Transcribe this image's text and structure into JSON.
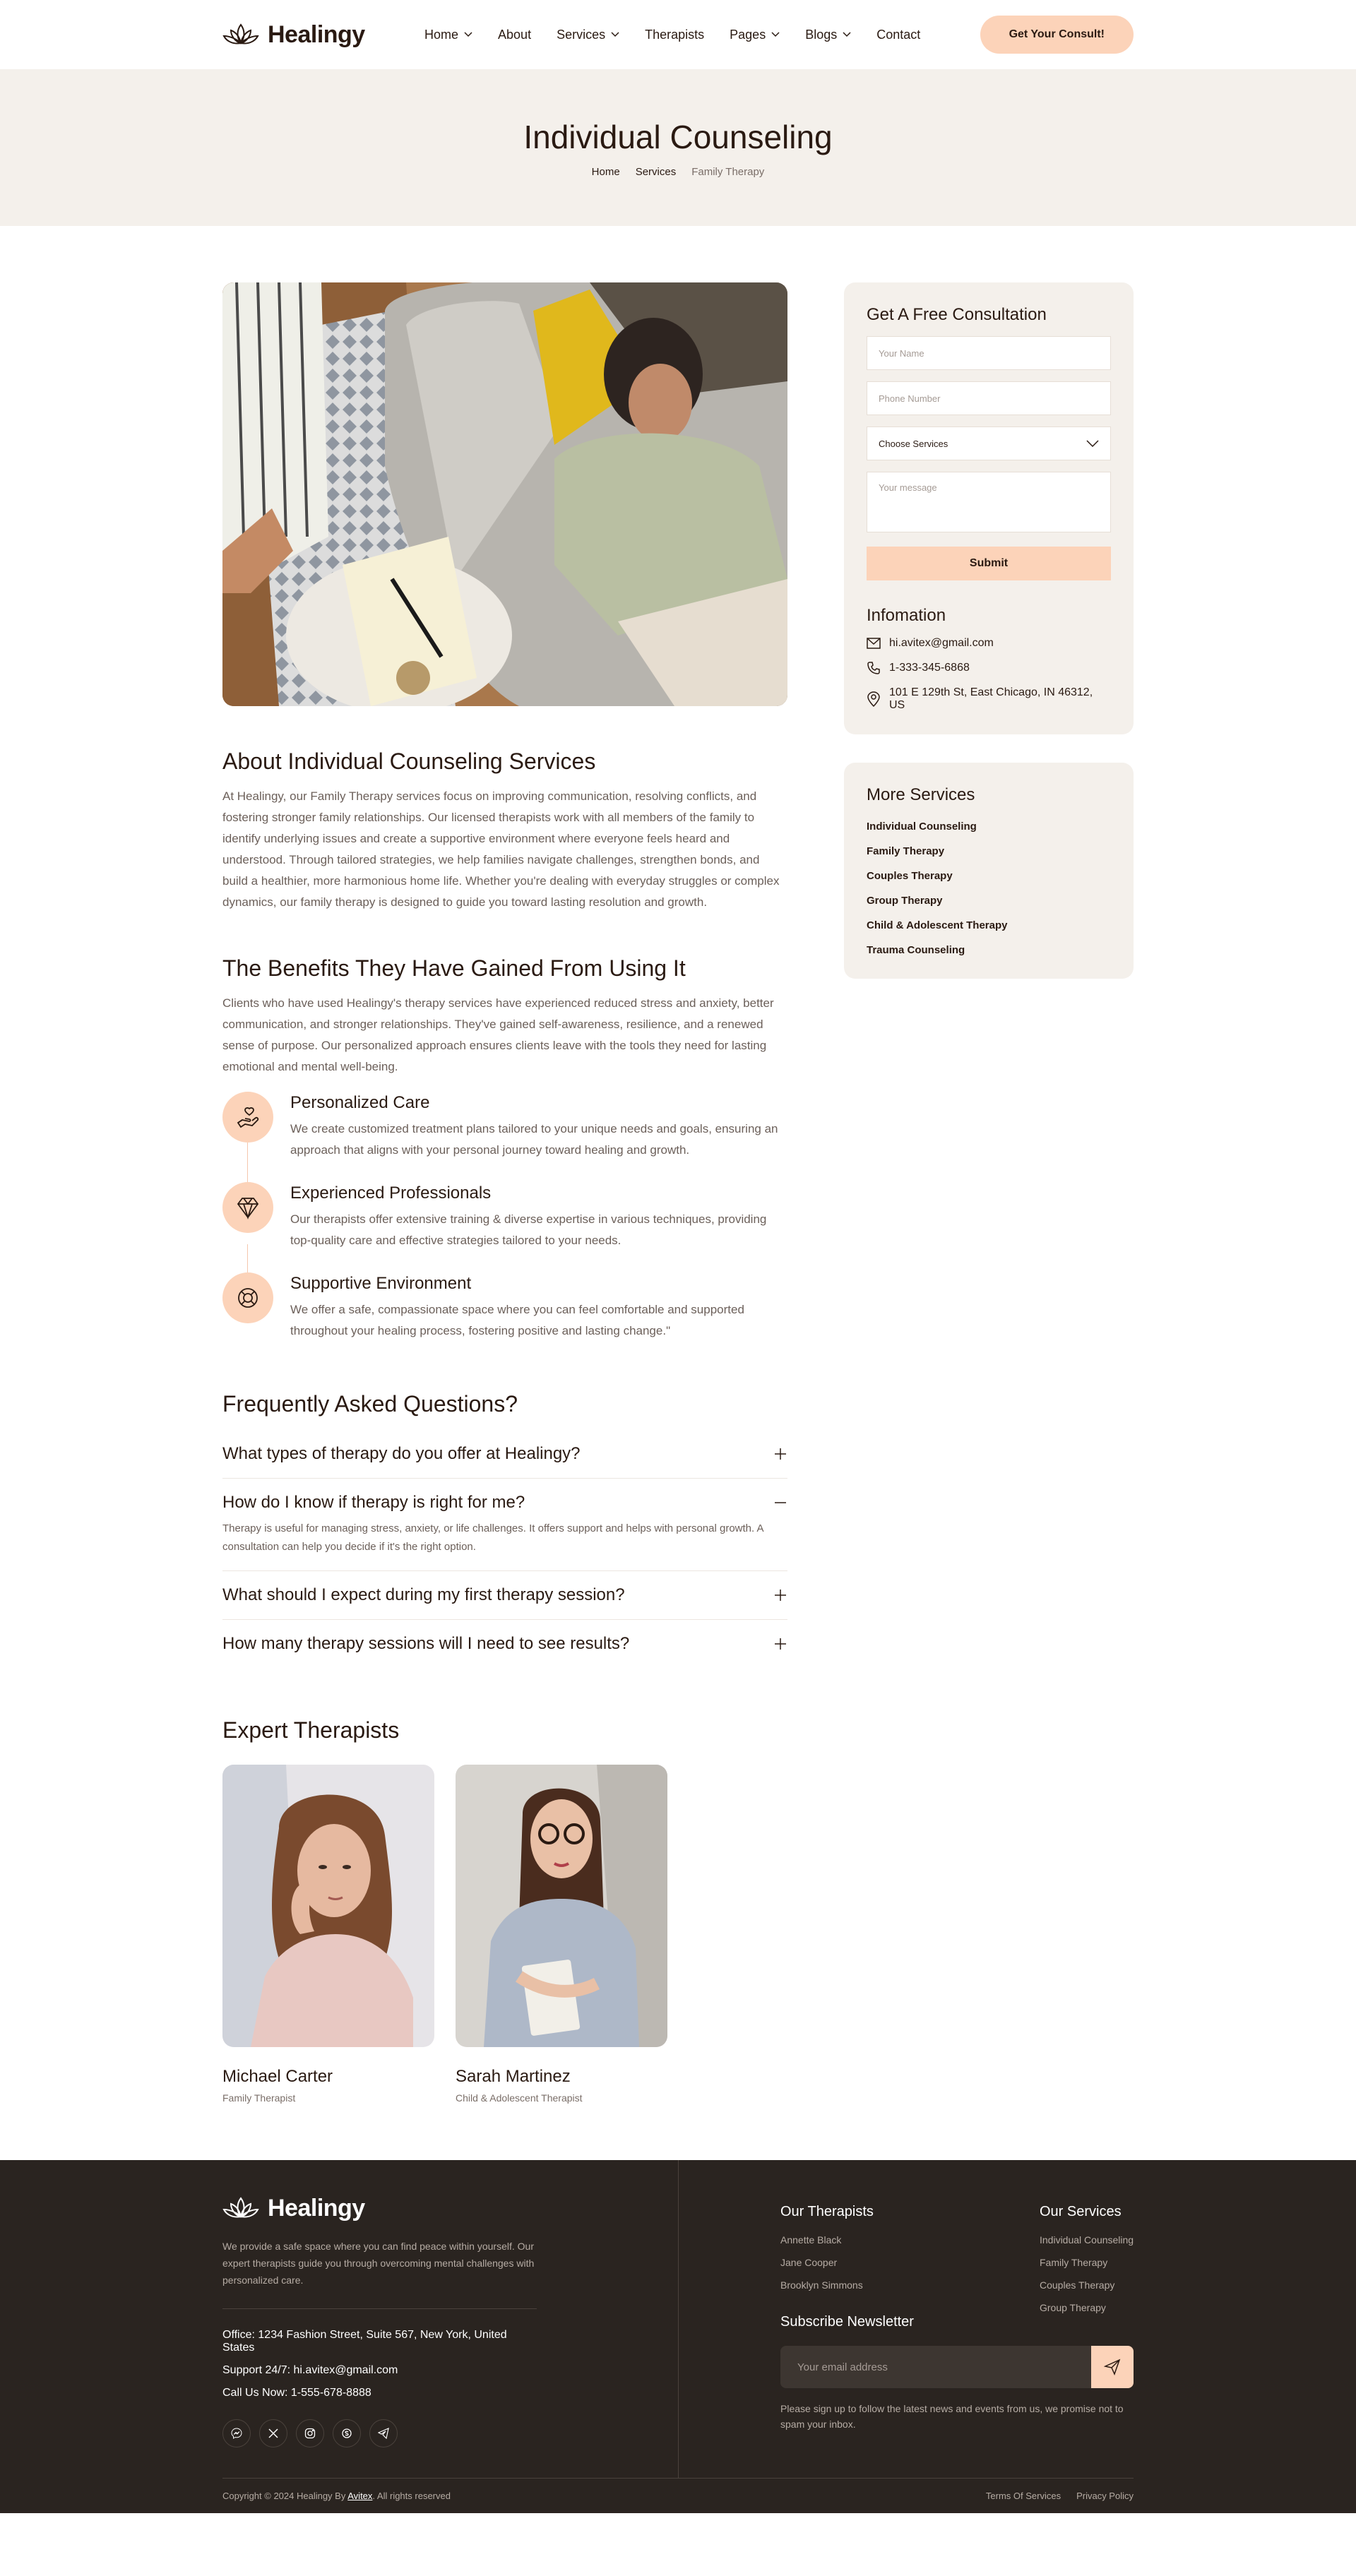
{
  "header": {
    "brand": "Healingy",
    "nav": [
      {
        "label": "Home",
        "dropdown": true
      },
      {
        "label": "About",
        "dropdown": false
      },
      {
        "label": "Services",
        "dropdown": true
      },
      {
        "label": "Therapists",
        "dropdown": false
      },
      {
        "label": "Pages",
        "dropdown": true
      },
      {
        "label": "Blogs",
        "dropdown": true
      },
      {
        "label": "Contact",
        "dropdown": false
      }
    ],
    "cta": "Get Your Consult!"
  },
  "hero": {
    "title": "Individual Counseling",
    "breadcrumb": [
      "Home",
      "Services",
      "Family Therapy"
    ]
  },
  "about": {
    "title": "About Individual Counseling Services",
    "text": "At Healingy, our Family Therapy services focus on improving communication, resolving conflicts, and fostering stronger family relationships. Our licensed therapists work with all members of the family to identify underlying issues and create a supportive environment where everyone feels heard and understood. Through tailored strategies, we help families navigate challenges, strengthen bonds, and build a healthier, more harmonious home life. Whether you're dealing with everyday struggles or complex dynamics, our family therapy is designed to guide you toward lasting resolution and growth."
  },
  "benefits": {
    "title": "The Benefits They Have Gained From Using It",
    "text": "Clients who have used Healingy's therapy services have experienced reduced stress and anxiety, better communication, and stronger relationships. They've gained self-awareness, resilience, and a renewed sense of purpose. Our personalized approach ensures clients leave with the tools they need for lasting emotional and mental well-being.",
    "items": [
      {
        "title": "Personalized Care",
        "text": "We create customized treatment plans tailored to your unique needs and goals, ensuring an approach that aligns with your personal journey toward healing and growth.",
        "icon": "hand-heart-icon"
      },
      {
        "title": "Experienced Professionals",
        "text": "Our therapists offer extensive training & diverse expertise in various techniques, providing top-quality care and effective strategies tailored to your needs.",
        "icon": "diamond-icon"
      },
      {
        "title": "Supportive Environment",
        "text": "We offer a safe, compassionate space where you can feel comfortable and supported throughout your healing process, fostering positive and lasting change.\"",
        "icon": "lifebuoy-icon"
      }
    ]
  },
  "faq": {
    "title": "Frequently Asked Questions?",
    "items": [
      {
        "q": "What types of therapy do you offer at Healingy?",
        "open": false,
        "a": ""
      },
      {
        "q": "How do I know if therapy is right for me?",
        "open": true,
        "a": "Therapy is useful for managing stress, anxiety, or life challenges. It offers support and helps with personal growth. A consultation can help you decide if it's the right option."
      },
      {
        "q": "What should I expect during my first therapy session?",
        "open": false,
        "a": ""
      },
      {
        "q": "How many therapy sessions will I need to see results?",
        "open": false,
        "a": ""
      }
    ]
  },
  "experts": {
    "title": "Expert Therapists",
    "members": [
      {
        "name": "Michael Carter",
        "role": "Family Therapist"
      },
      {
        "name": "Sarah Martinez",
        "role": "Child & Adolescent Therapist"
      }
    ]
  },
  "consult": {
    "title": "Get A Free Consultation",
    "name_placeholder": "Your Name",
    "phone_placeholder": "Phone Number",
    "service_select": "Choose Services",
    "message_placeholder": "Your message",
    "submit": "Submit"
  },
  "info": {
    "title": "Infomation",
    "email": "hi.avitex@gmail.com",
    "phone": "1-333-345-6868",
    "address": "101 E 129th St, East Chicago, IN 46312, US"
  },
  "more_services": {
    "title": "More Services",
    "items": [
      "Individual Counseling",
      "Family Therapy",
      "Couples Therapy",
      "Group Therapy",
      "Child & Adolescent Therapy",
      "Trauma Counseling"
    ]
  },
  "footer": {
    "brand": "Healingy",
    "desc": "We provide a safe space where you can find peace within yourself. Our expert therapists guide you through overcoming mental challenges with personalized care.",
    "office": "Office: 1234 Fashion Street, Suite 567, New York, United States",
    "support": "Support 24/7: hi.avitex@gmail.com",
    "call": "Call Us Now: 1-555-678-8888",
    "therapists_title": "Our Therapists",
    "therapists": [
      "Annette Black",
      "Jane Cooper",
      "Brooklyn Simmons"
    ],
    "services_title": "Our Services",
    "services": [
      "Individual Counseling",
      "Family Therapy",
      "Couples Therapy",
      "Group Therapy"
    ],
    "newsletter_title": "Subscribe Newsletter",
    "newsletter_placeholder": "Your email address",
    "newsletter_note": "Please sign up to follow the latest news and events from us, we promise not to spam your inbox.",
    "copyright_prefix": "Copyright © 2024 Healingy By",
    "copyright_brand": "Avitex",
    "copyright_suffix": ". All rights reserved",
    "terms": "Terms Of Services",
    "privacy": "Privacy Policy"
  },
  "colors": {
    "accent": "#fcd3b9",
    "soft_bg": "#f4f0eb",
    "dark": "#2a2420",
    "text": "#2a1a12"
  }
}
